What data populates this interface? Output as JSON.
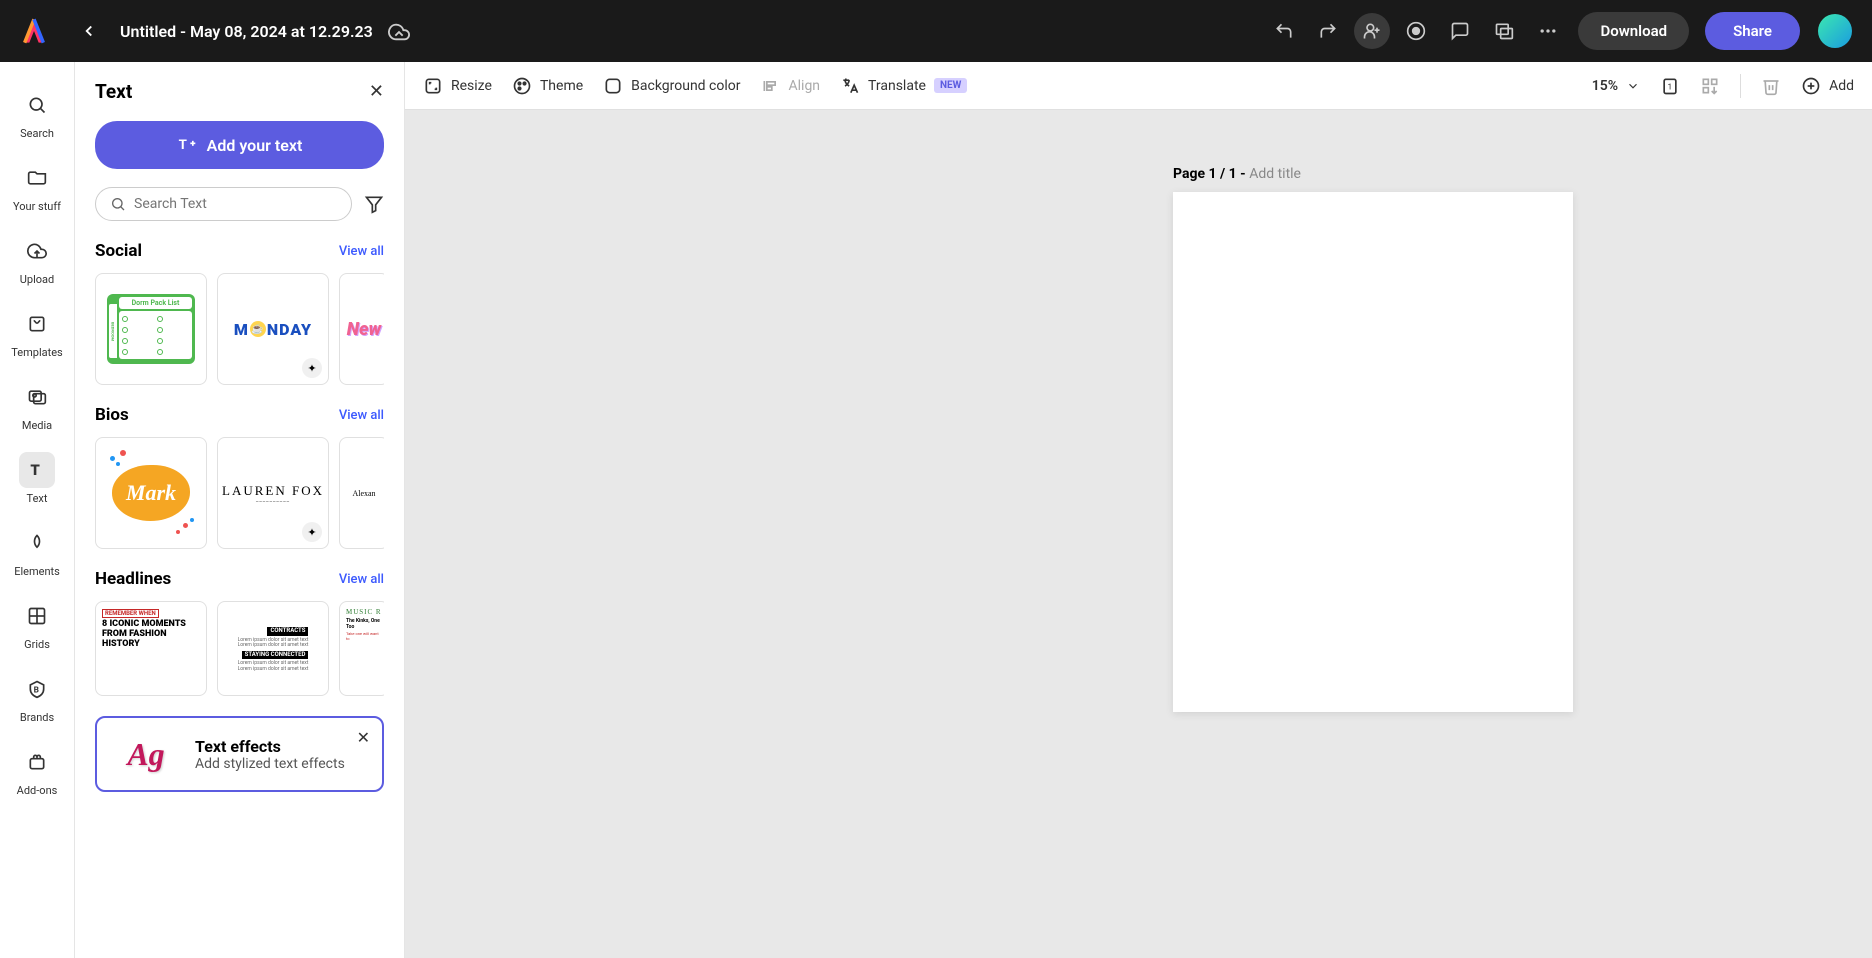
{
  "header": {
    "doc_title": "Untitled - May 08, 2024 at 12.29.23",
    "download_label": "Download",
    "share_label": "Share"
  },
  "rail": {
    "items": [
      {
        "id": "search",
        "label": "Search"
      },
      {
        "id": "yourstuff",
        "label": "Your stuff"
      },
      {
        "id": "upload",
        "label": "Upload"
      },
      {
        "id": "templates",
        "label": "Templates"
      },
      {
        "id": "media",
        "label": "Media"
      },
      {
        "id": "text",
        "label": "Text"
      },
      {
        "id": "elements",
        "label": "Elements"
      },
      {
        "id": "grids",
        "label": "Grids"
      },
      {
        "id": "brands",
        "label": "Brands"
      },
      {
        "id": "addons",
        "label": "Add-ons"
      }
    ]
  },
  "panel": {
    "title": "Text",
    "add_text_label": "Add your text",
    "search_placeholder": "Search Text",
    "view_all_label": "View all",
    "sections": {
      "social": "Social",
      "bios": "Bios",
      "headlines": "Headlines"
    },
    "thumbs": {
      "dorm_title": "Dorm Pack List",
      "dorm_tab": "BEDROOM",
      "monday": "M NDAY",
      "new": "New",
      "mark": "Mark",
      "lauren": "LAUREN FOX",
      "alex": "Alexan",
      "hl_remember": "REMEMBER WHEN",
      "hl_iconic": "8 ICONIC MOMENTS FROM FASHION HISTORY",
      "hl_contracts": "CONTRACTS",
      "hl_staying": "STAYING CONNECTED",
      "hl_music": "MUSIC R",
      "hl_kinks": "The Kinks, One Too"
    },
    "effects": {
      "title": "Text effects",
      "subtitle": "Add stylized text effects",
      "glyph": "Ag"
    }
  },
  "toolbar": {
    "resize": "Resize",
    "theme": "Theme",
    "background": "Background color",
    "align": "Align",
    "translate": "Translate",
    "new_badge": "NEW",
    "zoom": "15%",
    "add": "Add"
  },
  "canvas": {
    "page_label": "Page 1 / 1 - ",
    "add_title": "Add title"
  }
}
